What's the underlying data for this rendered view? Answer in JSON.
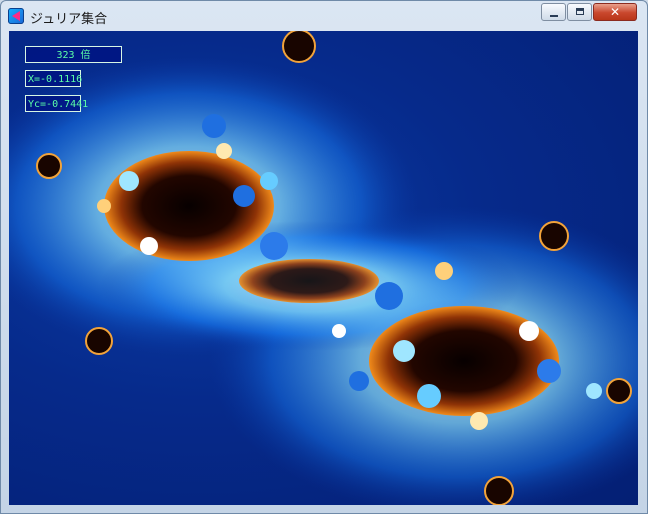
{
  "window": {
    "title": "ジュリア集合"
  },
  "controls": {
    "close": "✕"
  },
  "info": {
    "zoom": "323 倍",
    "x": "X=-0.1116",
    "y": "Yc=-0.7441"
  },
  "colors": {
    "background_blue": "#062a8b",
    "glow_cyan": "#8fe6ff",
    "core_black": "#120400",
    "flame_orange": "#f08a1a"
  }
}
